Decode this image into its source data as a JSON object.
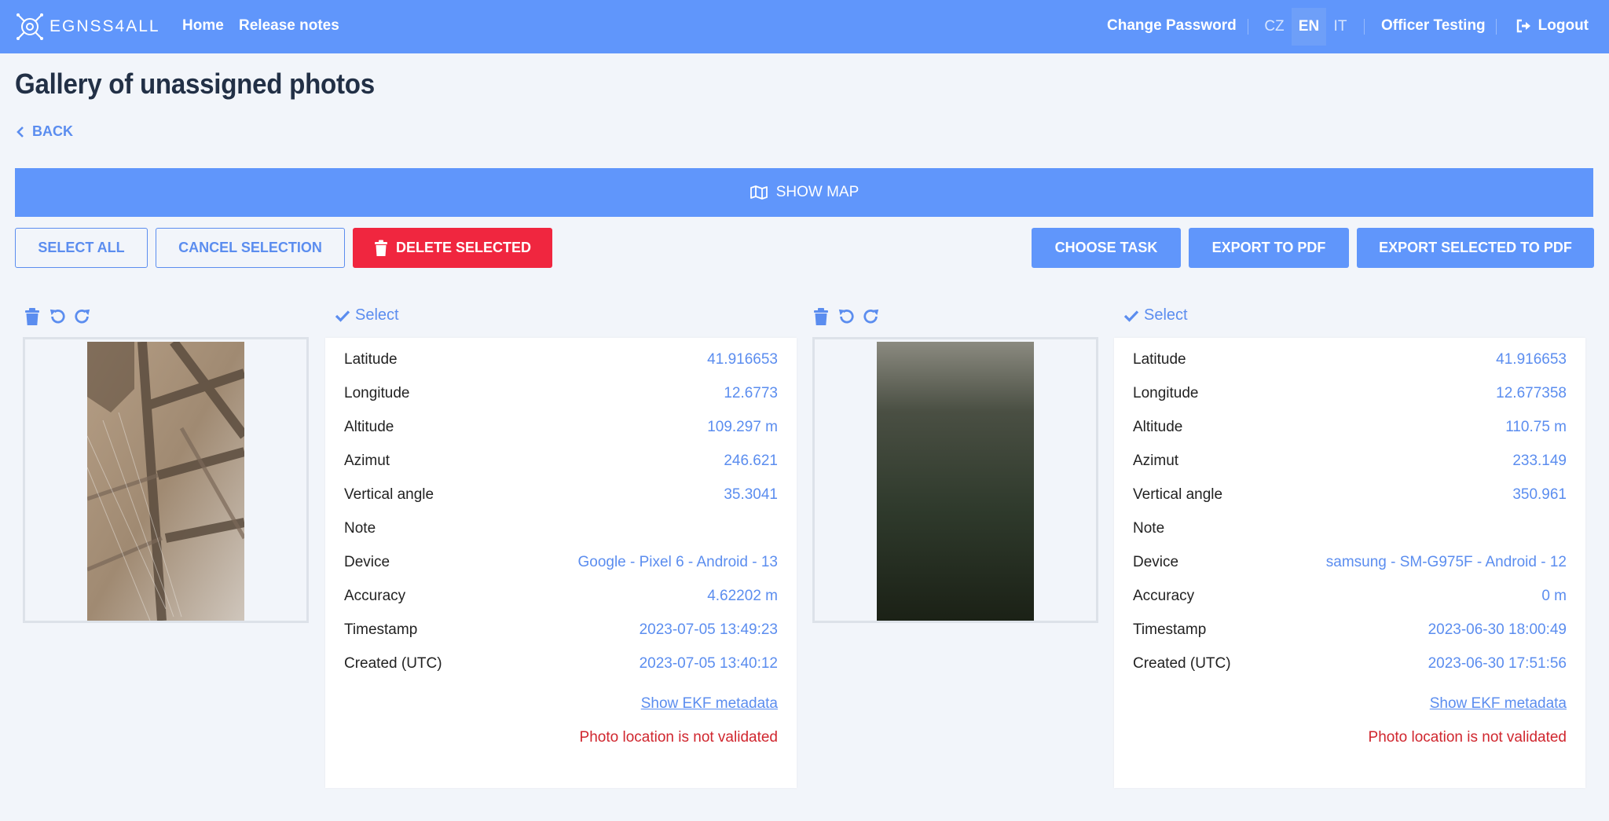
{
  "nav": {
    "brand": "EGNSS4ALL",
    "home": "Home",
    "release_notes": "Release notes",
    "change_password": "Change Password",
    "langs": [
      "CZ",
      "EN",
      "IT"
    ],
    "active_lang": "EN",
    "user": "Officer Testing",
    "logout": "Logout"
  },
  "page": {
    "title": "Gallery of unassigned photos",
    "back": "BACK",
    "show_map": "SHOW MAP"
  },
  "actions": {
    "select_all": "SELECT ALL",
    "cancel_selection": "CANCEL SELECTION",
    "delete_selected": "DELETE SELECTED",
    "choose_task": "CHOOSE TASK",
    "export_pdf": "EXPORT TO PDF",
    "export_selected_pdf": "EXPORT SELECTED TO PDF"
  },
  "labels": {
    "select": "Select",
    "latitude": "Latitude",
    "longitude": "Longitude",
    "altitude": "Altitude",
    "azimut": "Azimut",
    "vertical_angle": "Vertical angle",
    "note": "Note",
    "device": "Device",
    "accuracy": "Accuracy",
    "timestamp": "Timestamp",
    "created": "Created (UTC)",
    "show_ekf": "Show EKF metadata",
    "not_validated": "Photo location is not validated"
  },
  "photos": [
    {
      "latitude": "41.916653",
      "longitude": "12.6773",
      "altitude": "109.297 m",
      "azimut": "246.621",
      "vertical_angle": "35.3041",
      "note": "",
      "device": "Google - Pixel 6 - Android - 13",
      "accuracy": "4.62202 m",
      "timestamp": "2023-07-05 13:49:23",
      "created": "2023-07-05 13:40:12"
    },
    {
      "latitude": "41.916653",
      "longitude": "12.677358",
      "altitude": "110.75 m",
      "azimut": "233.149",
      "vertical_angle": "350.961",
      "note": "",
      "device": "samsung - SM-G975F - Android - 12",
      "accuracy": "0 m",
      "timestamp": "2023-06-30 18:00:49",
      "created": "2023-06-30 17:51:56"
    }
  ],
  "colors": {
    "primary": "#6096fb",
    "danger": "#f0263f",
    "link": "#5b8def",
    "warning_text": "#d0262e",
    "background": "#f2f5fa"
  }
}
